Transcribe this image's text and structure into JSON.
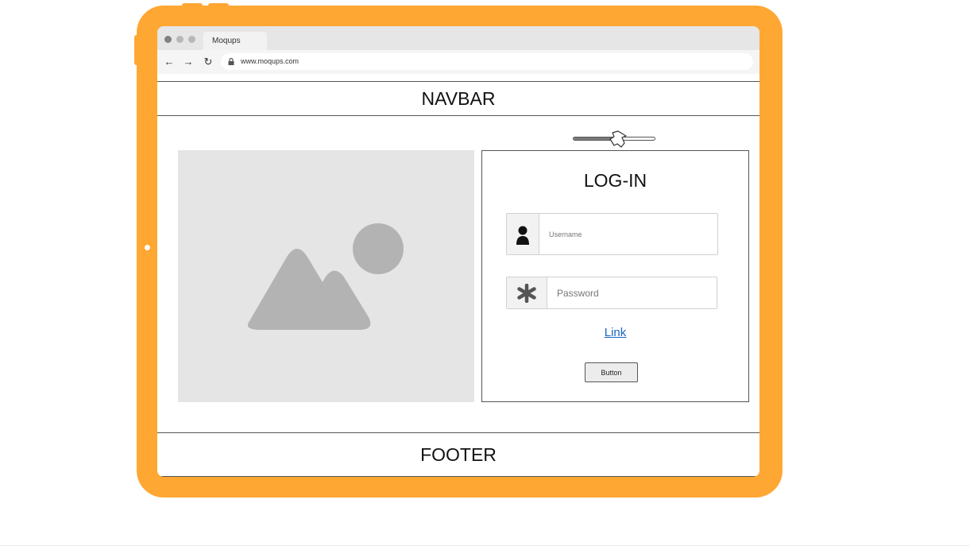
{
  "browser": {
    "tab_label": "Moqups",
    "url": "www.moqups.com"
  },
  "navbar": {
    "label": "NAVBAR"
  },
  "slider": {
    "value_percent": 55
  },
  "login": {
    "title": "LOG-IN",
    "username_placeholder": "Username",
    "password_placeholder": "Password",
    "link_label": "Link",
    "button_label": "Button"
  },
  "footer": {
    "label": "FOOTER"
  },
  "colors": {
    "tablet_frame": "#ffa733",
    "link": "#1a66c4",
    "placeholder_bg": "#e5e5e5",
    "placeholder_shape": "#b3b3b3"
  },
  "icons": {
    "back": "arrow-left-icon",
    "forward": "arrow-right-icon",
    "reload": "reload-icon",
    "lock": "lock-icon",
    "user": "user-icon",
    "password": "asterisk-icon",
    "image": "image-placeholder-icon"
  }
}
